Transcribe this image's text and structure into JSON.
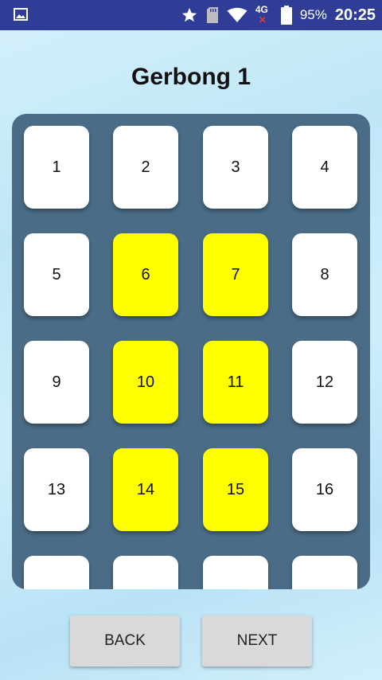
{
  "status_bar": {
    "network": "4G",
    "battery_percent": "95%",
    "time": "20:25",
    "background_color": "#2f3d96",
    "icons": [
      "gallery-icon",
      "star-icon",
      "sd-card-icon",
      "wifi-icon",
      "mobile-data-off-icon",
      "battery-icon"
    ]
  },
  "title": "Gerbong 1",
  "seats": [
    {
      "label": "1",
      "selected": false
    },
    {
      "label": "2",
      "selected": false
    },
    {
      "label": "3",
      "selected": false
    },
    {
      "label": "4",
      "selected": false
    },
    {
      "label": "5",
      "selected": false
    },
    {
      "label": "6",
      "selected": true
    },
    {
      "label": "7",
      "selected": true
    },
    {
      "label": "8",
      "selected": false
    },
    {
      "label": "9",
      "selected": false
    },
    {
      "label": "10",
      "selected": true
    },
    {
      "label": "11",
      "selected": true
    },
    {
      "label": "12",
      "selected": false
    },
    {
      "label": "13",
      "selected": false
    },
    {
      "label": "14",
      "selected": true
    },
    {
      "label": "15",
      "selected": true
    },
    {
      "label": "16",
      "selected": false
    },
    {
      "label": "",
      "selected": false
    },
    {
      "label": "",
      "selected": false
    },
    {
      "label": "",
      "selected": false
    },
    {
      "label": "",
      "selected": false
    }
  ],
  "colors": {
    "panel": "#4a6c86",
    "seat_available": "#ffffff",
    "seat_selected": "#ffff00"
  },
  "buttons": {
    "back_label": "BACK",
    "next_label": "NEXT"
  }
}
